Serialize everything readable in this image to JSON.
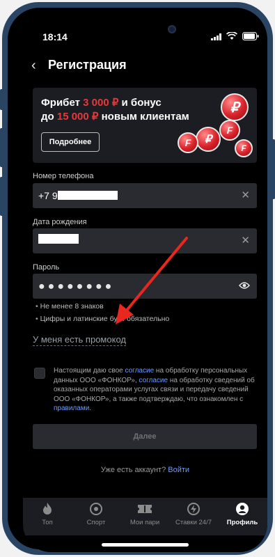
{
  "status": {
    "time": "18:14"
  },
  "nav": {
    "back": "‹",
    "title": "Регистрация"
  },
  "banner": {
    "line1_a": "Фрибет ",
    "line1_red": "3 000 ₽",
    "line1_b": " и бонус",
    "line2_a": "до ",
    "line2_red": "15 000 ₽",
    "line2_b": " новым клиентам",
    "button": "Подробнее"
  },
  "form": {
    "phone_label": "Номер телефона",
    "phone_prefix": "+7 9",
    "birth_label": "Дата рождения",
    "password_label": "Пароль",
    "password_dots": "●●●●●●●●",
    "clear": "✕",
    "hints": [
      "Не менее 8 знаков",
      "Цифры и латинские бу… обязательно"
    ]
  },
  "promo": "У меня есть промокод",
  "consent": {
    "t1": "Настоящим даю свое ",
    "l1": "согласие",
    "t2": " на обработку персональных данных ООО «ФОНКОР», ",
    "l2": "согласие",
    "t3": " на обработку сведений об оказанных операторами услугах связи и передачу сведений ООО «ФОНКОР», а также подтверждаю, что ознакомлен с ",
    "l3": "правилами",
    "t4": "."
  },
  "next_button": "Далее",
  "account": {
    "text": "Уже есть аккаунт? ",
    "login": "Войти"
  },
  "tabs": [
    {
      "label": "Топ",
      "icon": "flame-icon"
    },
    {
      "label": "Спорт",
      "icon": "ball-icon"
    },
    {
      "label": "Мои пари",
      "icon": "ticket-icon"
    },
    {
      "label": "Ставки 24/7",
      "icon": "bolt-icon"
    },
    {
      "label": "Профиль",
      "icon": "user-icon"
    }
  ],
  "colors": {
    "accent_red": "#e5393b",
    "link_blue": "#6e9cff",
    "annotation_arrow": "#e8271f"
  }
}
